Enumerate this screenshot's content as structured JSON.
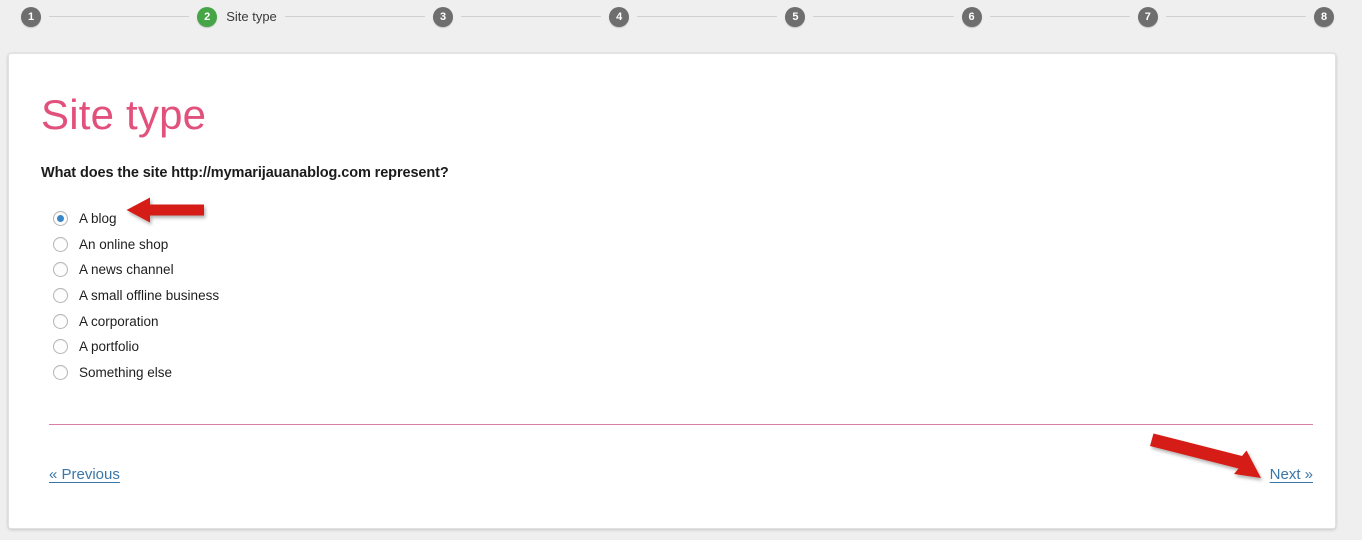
{
  "stepper": {
    "steps": [
      {
        "number": "1",
        "label": "",
        "state": "pending"
      },
      {
        "number": "2",
        "label": "Site type",
        "state": "active"
      },
      {
        "number": "3",
        "label": "",
        "state": "pending"
      },
      {
        "number": "4",
        "label": "",
        "state": "pending"
      },
      {
        "number": "5",
        "label": "",
        "state": "pending"
      },
      {
        "number": "6",
        "label": "",
        "state": "pending"
      },
      {
        "number": "7",
        "label": "",
        "state": "pending"
      },
      {
        "number": "8",
        "label": "",
        "state": "pending"
      }
    ],
    "active_color": "#46a546",
    "pending_color": "#6e6e6e",
    "connector_color": "#d0d0d0"
  },
  "card": {
    "title": "Site type",
    "title_color": "#e2507c",
    "question": "What does the site http://mymarijauanablog.com represent?",
    "divider_color": "#d97fa7",
    "options": [
      {
        "label": "A blog",
        "checked": true
      },
      {
        "label": "An online shop",
        "checked": false
      },
      {
        "label": "A news channel",
        "checked": false
      },
      {
        "label": "A small offline business",
        "checked": false
      },
      {
        "label": "A corporation",
        "checked": false
      },
      {
        "label": "A portfolio",
        "checked": false
      },
      {
        "label": "Something else",
        "checked": false
      }
    ],
    "selected_option": "A blog",
    "radio_selected_color": "#3b86c8",
    "nav": {
      "previous_label": "« Previous",
      "next_label": "Next »",
      "link_color": "#3a76a8"
    }
  },
  "annotations": {
    "arrow_color": "#d61f16",
    "arrows": [
      {
        "name": "arrow-pointing-to-a-blog",
        "direction": "left",
        "target": "A blog"
      },
      {
        "name": "arrow-pointing-to-next",
        "direction": "down-right",
        "target": "Next »"
      }
    ]
  }
}
